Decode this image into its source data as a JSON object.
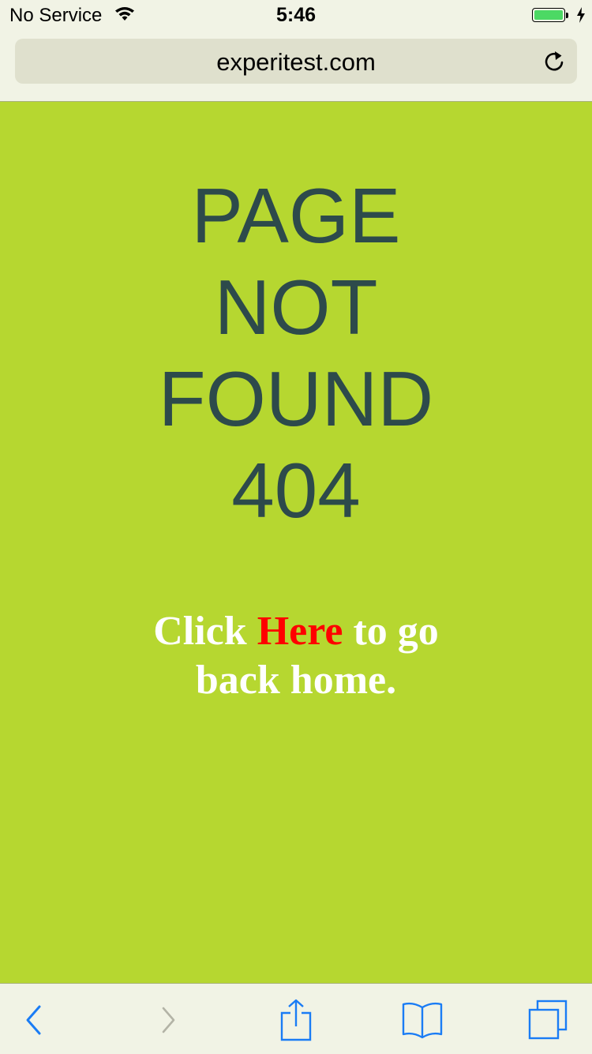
{
  "status": {
    "carrier": "No Service",
    "time": "5:46",
    "battery_level": 1.0,
    "charging": true
  },
  "browser": {
    "url": "experitest.com"
  },
  "page": {
    "background_color": "#b6d730",
    "title_lines": [
      "PAGE",
      "NOT",
      "FOUND",
      "404"
    ],
    "message_prefix": "Click ",
    "message_link": "Here",
    "message_suffix_line1": " to go",
    "message_line2": "back home.",
    "link_color": "#ff0000",
    "title_color": "#2d4a4b"
  },
  "toolbar": {
    "icons": [
      "back-icon",
      "forward-icon",
      "share-icon",
      "bookmarks-icon",
      "tabs-icon"
    ],
    "accent_color": "#1a7cf5"
  }
}
